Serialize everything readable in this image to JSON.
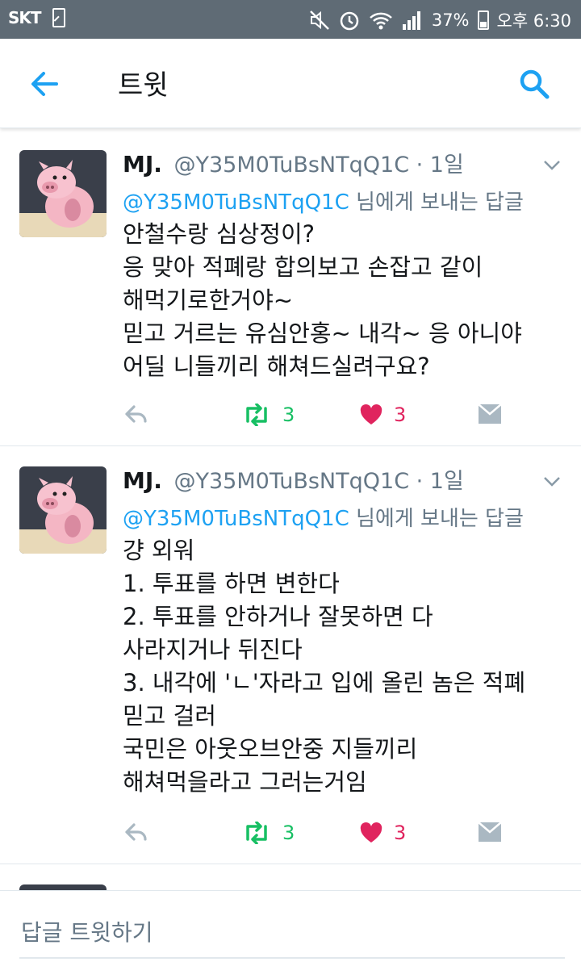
{
  "status_bar": {
    "carrier": "SKT",
    "battery": "37%",
    "time": "오후 6:30"
  },
  "header": {
    "title": "트윗",
    "back_icon": "arrow-left-icon",
    "search_icon": "search-icon"
  },
  "tweets": [
    {
      "name": "MJ.",
      "handle": "@Y35M0TuBsNTqQ1C",
      "time": "· 1일",
      "reply_handle": "@Y35M0TuBsNTqQ1C",
      "reply_suffix": "님에게 보내는 답글",
      "lines": [
        "안철수랑 심상정이?",
        "응 맞아 적폐랑 합의보고 손잡고 같이",
        "해먹기로한거야~",
        "믿고 거르는 유심안홍~ 내각~ 응 아니야",
        "어딜 니들끼리 해쳐드실려구요?"
      ],
      "retweets": "3",
      "likes": "3"
    },
    {
      "name": "MJ.",
      "handle": "@Y35M0TuBsNTqQ1C",
      "time": "· 1일",
      "reply_handle": "@Y35M0TuBsNTqQ1C",
      "reply_suffix": "님에게 보내는 답글",
      "lines": [
        "걍 외워",
        "1. 투표를 하면 변한다",
        "2. 투표를 안하거나 잘못하면 다",
        "사라지거나 뒤진다",
        "3. 내각에 'ㄴ'자라고 입에 올린 놈은 적폐",
        "믿고 걸러",
        "국민은 아웃오브안중 지들끼리",
        "해쳐먹을라고 그러는거임"
      ],
      "retweets": "3",
      "likes": "3"
    }
  ],
  "compose": {
    "placeholder": "답글 트윗하기"
  },
  "colors": {
    "accent": "#1da1f2",
    "retweet": "#17bf63",
    "like": "#e0245e",
    "status_bar": "#5f6b75"
  }
}
